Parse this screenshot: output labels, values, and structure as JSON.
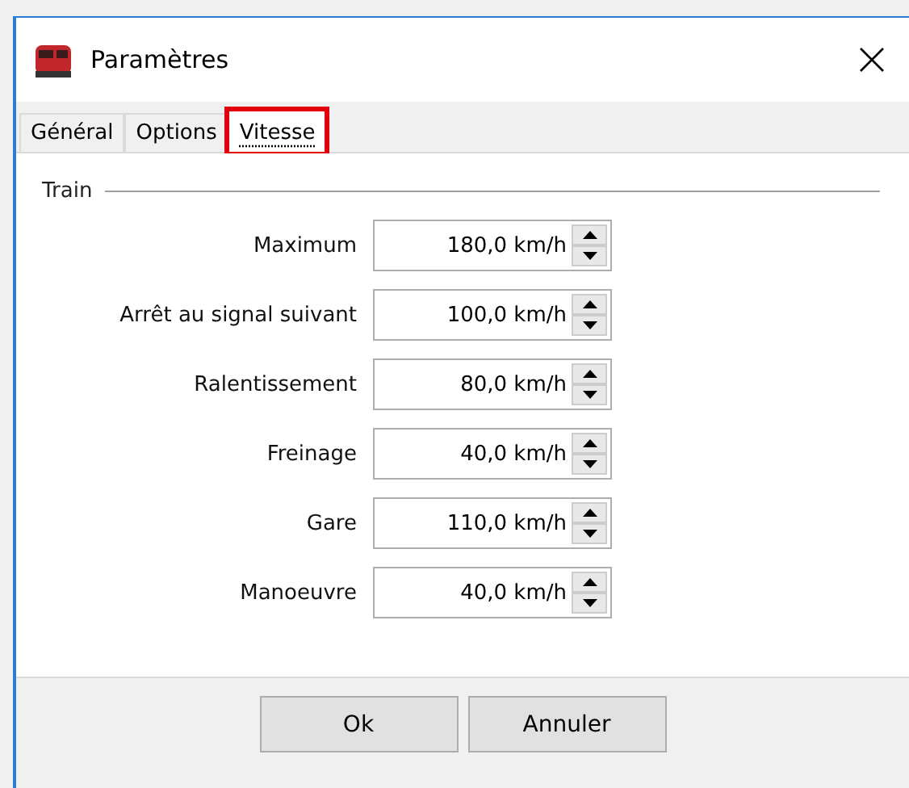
{
  "window": {
    "title": "Paramètres"
  },
  "tabs": [
    {
      "label": "Général",
      "selected": false,
      "highlighted": false
    },
    {
      "label": "Options",
      "selected": false,
      "highlighted": false
    },
    {
      "label": "Vitesse",
      "selected": true,
      "highlighted": true
    }
  ],
  "group": {
    "title": "Train"
  },
  "fields": [
    {
      "label": "Maximum",
      "value": "180,0 km/h"
    },
    {
      "label": "Arrêt au signal suivant",
      "value": "100,0 km/h"
    },
    {
      "label": "Ralentissement",
      "value": "80,0 km/h"
    },
    {
      "label": "Freinage",
      "value": "40,0 km/h"
    },
    {
      "label": "Gare",
      "value": "110,0 km/h"
    },
    {
      "label": "Manoeuvre",
      "value": "40,0 km/h"
    }
  ],
  "buttons": [
    "Ok",
    "Annuler"
  ]
}
